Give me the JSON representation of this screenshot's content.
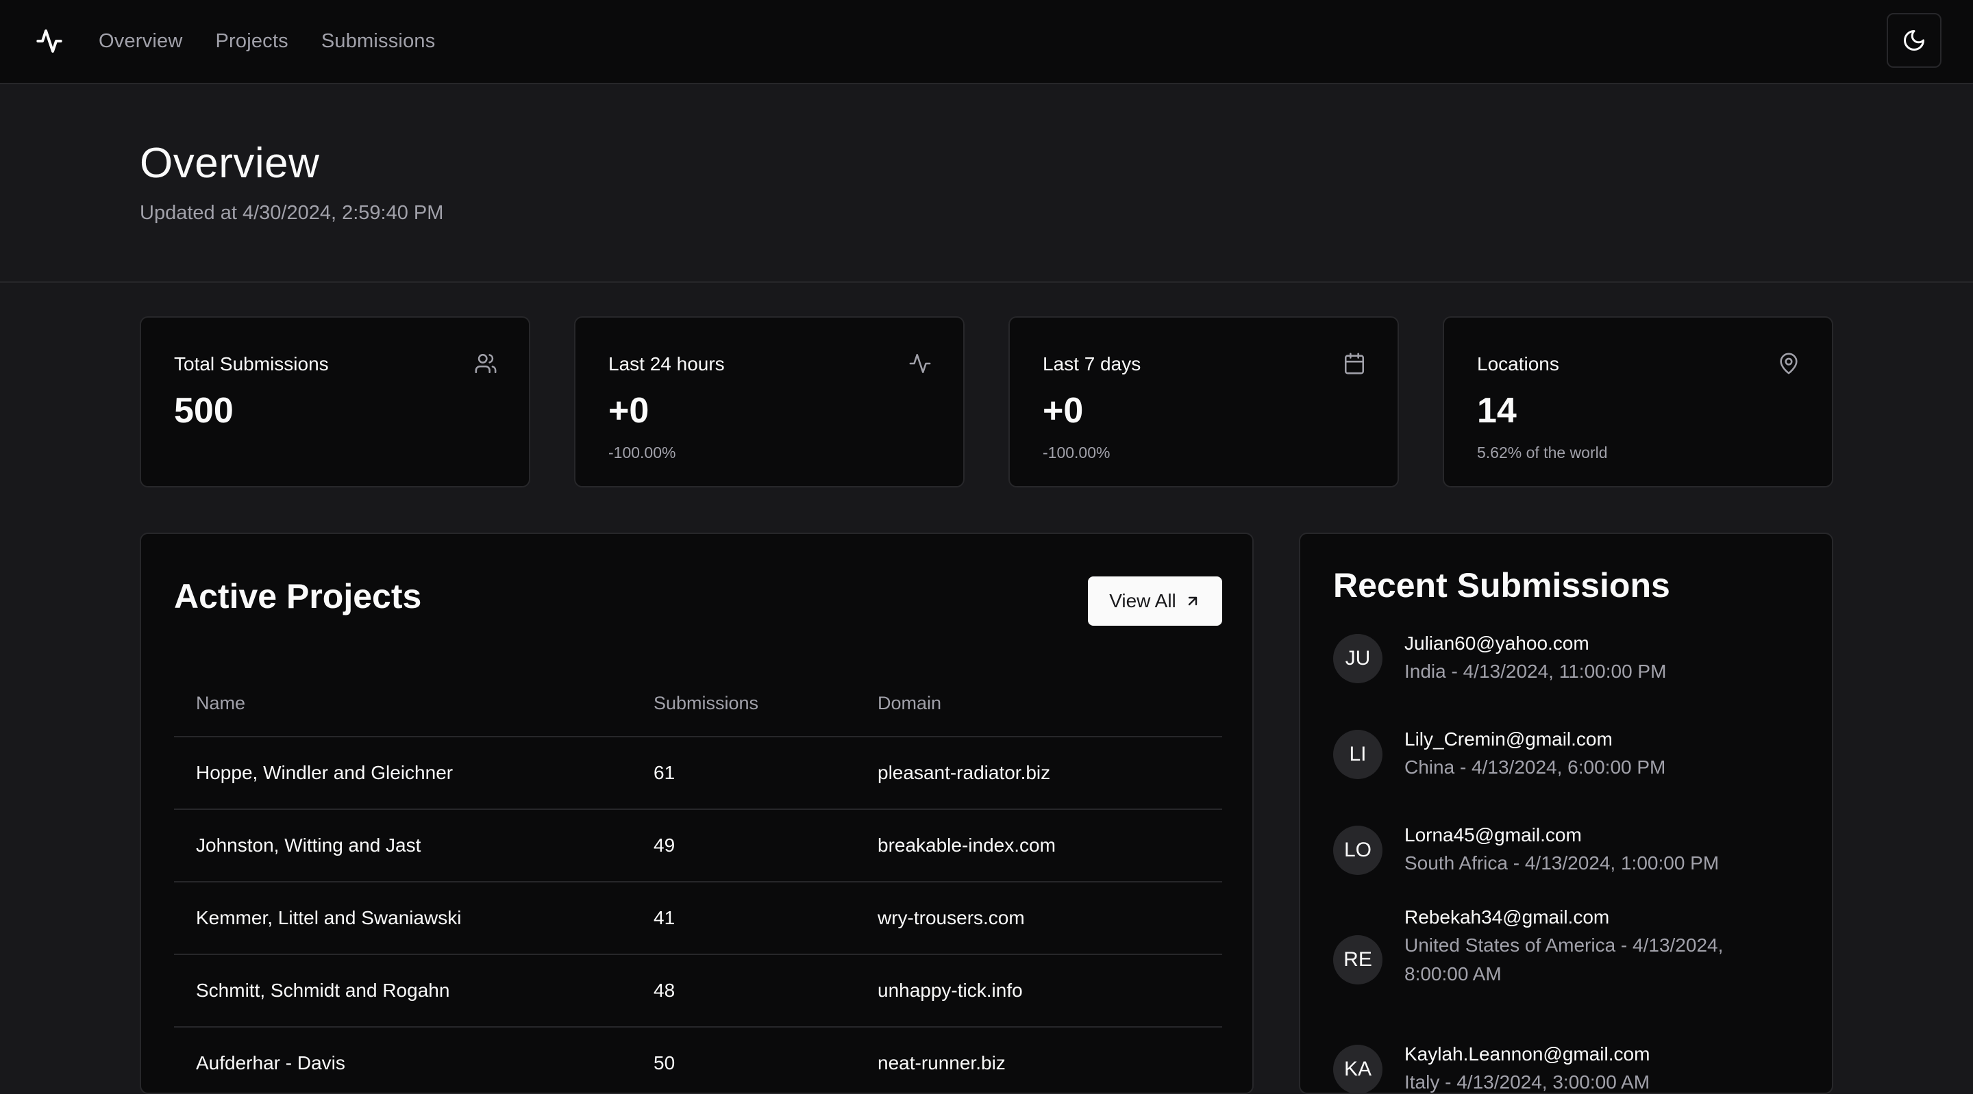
{
  "nav": {
    "items": [
      "Overview",
      "Projects",
      "Submissions"
    ]
  },
  "header": {
    "title": "Overview",
    "updated": "Updated at 4/30/2024, 2:59:40 PM"
  },
  "stats": [
    {
      "label": "Total Submissions",
      "value": "500",
      "sub": "",
      "icon": "users-icon"
    },
    {
      "label": "Last 24 hours",
      "value": "+0",
      "sub": "-100.00%",
      "icon": "activity-icon"
    },
    {
      "label": "Last 7 days",
      "value": "+0",
      "sub": "-100.00%",
      "icon": "calendar-icon"
    },
    {
      "label": "Locations",
      "value": "14",
      "sub": "5.62% of the world",
      "icon": "map-pin-icon"
    }
  ],
  "projects": {
    "title": "Active Projects",
    "view_all": "View All",
    "columns": [
      "Name",
      "Submissions",
      "Domain"
    ],
    "rows": [
      [
        "Hoppe, Windler and Gleichner",
        "61",
        "pleasant-radiator.biz"
      ],
      [
        "Johnston, Witting and Jast",
        "49",
        "breakable-index.com"
      ],
      [
        "Kemmer, Littel and Swaniawski",
        "41",
        "wry-trousers.com"
      ],
      [
        "Schmitt, Schmidt and Rogahn",
        "48",
        "unhappy-tick.info"
      ],
      [
        "Aufderhar - Davis",
        "50",
        "neat-runner.biz"
      ]
    ]
  },
  "recent": {
    "title": "Recent Submissions",
    "items": [
      {
        "initials": "JU",
        "email": "Julian60@yahoo.com",
        "meta": "India - 4/13/2024, 11:00:00 PM"
      },
      {
        "initials": "LI",
        "email": "Lily_Cremin@gmail.com",
        "meta": "China - 4/13/2024, 6:00:00 PM"
      },
      {
        "initials": "LO",
        "email": "Lorna45@gmail.com",
        "meta": "South Africa - 4/13/2024, 1:00:00 PM"
      },
      {
        "initials": "RE",
        "email": "Rebekah34@gmail.com",
        "meta": "United States of America - 4/13/2024, 8:00:00 AM"
      },
      {
        "initials": "KA",
        "email": "Kaylah.Leannon@gmail.com",
        "meta": "Italy - 4/13/2024, 3:00:00 AM"
      }
    ]
  },
  "colors": {
    "background": "#18181b",
    "card": "#0a0a0b",
    "border": "#27272a",
    "muted": "#a1a1aa",
    "foreground": "#fafafa"
  }
}
